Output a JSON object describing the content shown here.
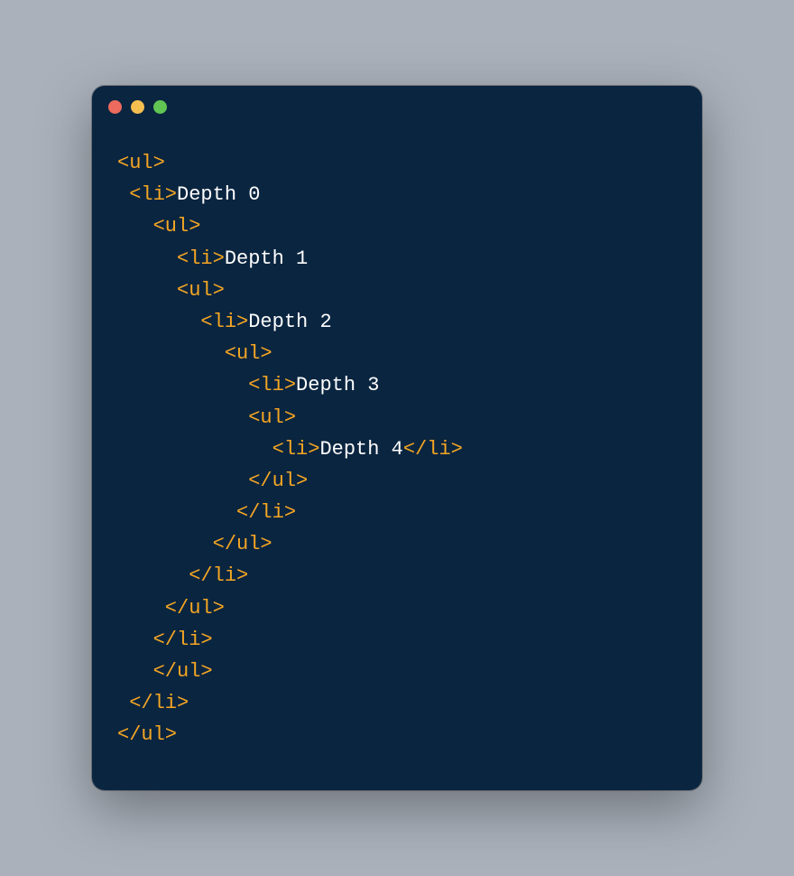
{
  "colors": {
    "window_bg": "#0a2540",
    "page_bg": "#aab1bb",
    "tag": "#f5a623",
    "text": "#ffffff",
    "close": "#ed6a5e",
    "min": "#f5bf4f",
    "max": "#61c554"
  },
  "code": {
    "lines": [
      [
        {
          "c": "t",
          "v": "<ul>"
        }
      ],
      [
        {
          "c": "t",
          "v": " <li>"
        },
        {
          "c": "x",
          "v": "Depth 0"
        }
      ],
      [
        {
          "c": "t",
          "v": "   <ul>"
        }
      ],
      [
        {
          "c": "t",
          "v": "     <li>"
        },
        {
          "c": "x",
          "v": "Depth 1"
        }
      ],
      [
        {
          "c": "t",
          "v": "     <ul>"
        }
      ],
      [
        {
          "c": "t",
          "v": "       <li>"
        },
        {
          "c": "x",
          "v": "Depth 2"
        }
      ],
      [
        {
          "c": "t",
          "v": "         <ul>"
        }
      ],
      [
        {
          "c": "t",
          "v": "           <li>"
        },
        {
          "c": "x",
          "v": "Depth 3"
        }
      ],
      [
        {
          "c": "t",
          "v": "           <ul>"
        }
      ],
      [
        {
          "c": "t",
          "v": "             <li>"
        },
        {
          "c": "x",
          "v": "Depth 4"
        },
        {
          "c": "t",
          "v": "</li>"
        }
      ],
      [
        {
          "c": "t",
          "v": "           </ul>"
        }
      ],
      [
        {
          "c": "t",
          "v": "          </li>"
        }
      ],
      [
        {
          "c": "t",
          "v": "        </ul>"
        }
      ],
      [
        {
          "c": "t",
          "v": "      </li>"
        }
      ],
      [
        {
          "c": "t",
          "v": "    </ul>"
        }
      ],
      [
        {
          "c": "t",
          "v": "   </li>"
        }
      ],
      [
        {
          "c": "t",
          "v": "   </ul>"
        }
      ],
      [
        {
          "c": "t",
          "v": " </li>"
        }
      ],
      [
        {
          "c": "t",
          "v": "</ul>"
        }
      ]
    ]
  }
}
